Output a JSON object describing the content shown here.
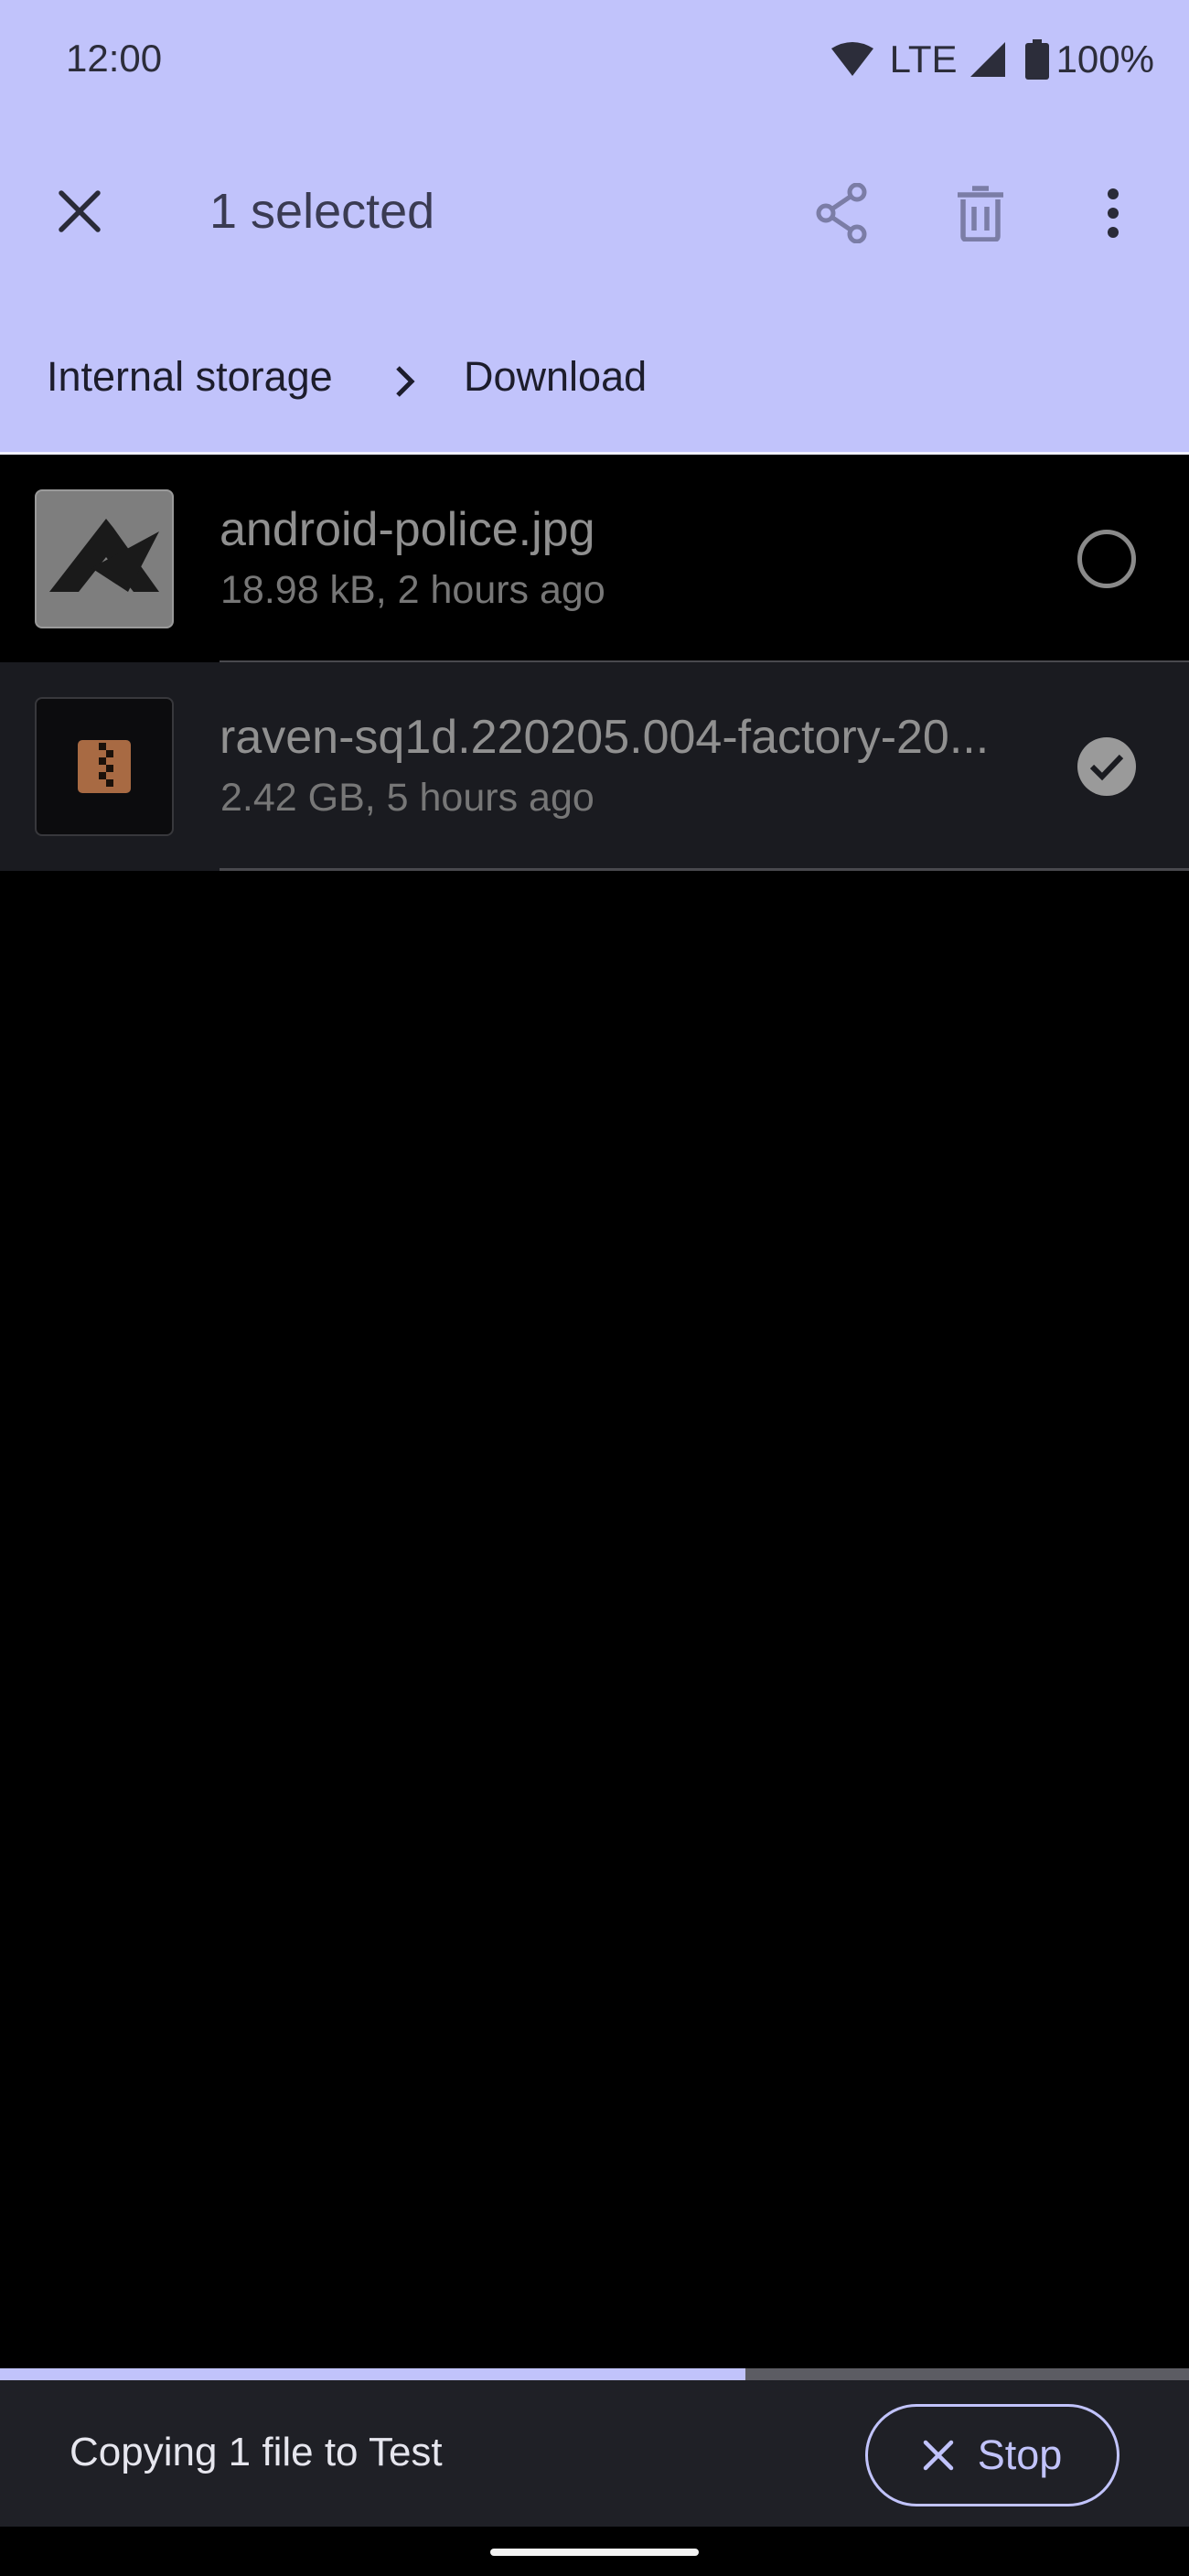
{
  "status_bar": {
    "time": "12:00",
    "network": "LTE",
    "battery": "100%",
    "icons": [
      "wifi-icon",
      "cell-signal-icon",
      "battery-icon"
    ]
  },
  "app_bar": {
    "title": "1 selected",
    "icons": [
      "close-icon",
      "share-icon",
      "delete-icon",
      "more-vert-icon"
    ]
  },
  "breadcrumb": {
    "items": [
      "Internal storage",
      "Download"
    ],
    "separator_icon": "chevron-right-icon"
  },
  "files": [
    {
      "name": "android-police.jpg",
      "meta": "18.98 kB, 2 hours ago",
      "selected": false,
      "thumbnail": "image-thumbnail"
    },
    {
      "name": "raven-sq1d.220205.004-factory-20...",
      "meta": "2.42 GB, 5 hours ago",
      "selected": true,
      "thumbnail": "zip-file-icon"
    }
  ],
  "progress": {
    "fraction": 0.627
  },
  "snackbar": {
    "message": "Copying 1 file to Test",
    "action_label": "Stop",
    "action_icon": "close-icon"
  },
  "colors": {
    "header_bg": "#c1c3fb",
    "accent": "#c1c3fb",
    "background": "#000000",
    "selected_row_bg": "#1a1b20",
    "snackbar_bg": "#1f2026"
  }
}
